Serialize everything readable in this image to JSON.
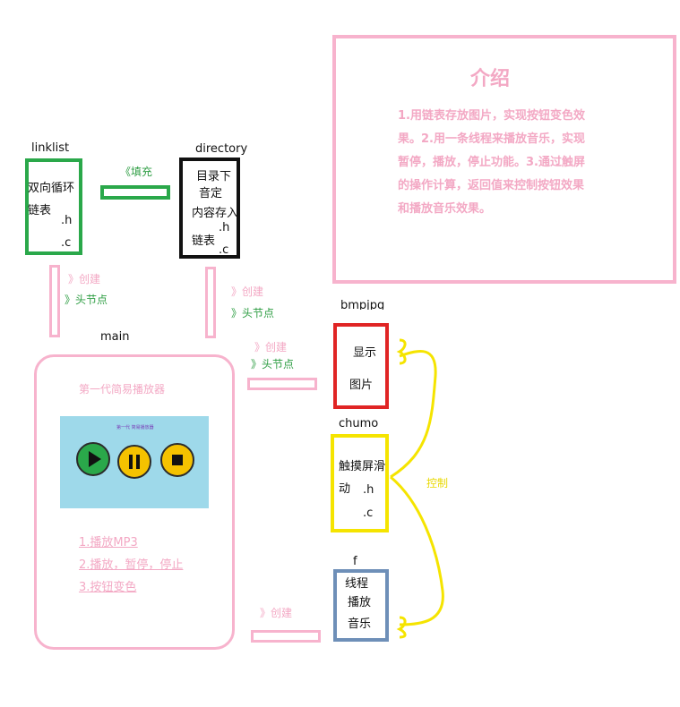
{
  "intro": {
    "title": "介绍",
    "body": "1.用链表存放图片，实现按钮变色效果。2.用一条线程来播放音乐，实现暂停，播放，停止功能。3.通过触屏的操作计算，返回值来控制按钮效果和播放音乐效果。"
  },
  "modules": {
    "linklist": {
      "name": "linklist",
      "line1": "双向循环",
      "line2": "链表",
      "h": ".h",
      "c": ".c",
      "color": "#2aa84a"
    },
    "directory": {
      "name": "directory",
      "line1": "目录下",
      "line2": "音定",
      "line3": "内容存入",
      "h": ".h",
      "line4": "链表",
      "c": ".c",
      "color": "#111111"
    },
    "main": {
      "name": "main",
      "player_title": "第一代简易播放器",
      "player_caption": "第一代 简易播放器",
      "color": "#f7b3cd"
    },
    "bmpjpg": {
      "name": "bmpjpg",
      "line1": "显示",
      "line2": "图片",
      "color": "#e02424"
    },
    "chumo": {
      "name": "chumo",
      "line1": "触摸屏滑",
      "line2": "动",
      "h": ".h",
      "c": ".c",
      "color": "#f5e400"
    },
    "f": {
      "name": "f",
      "line1": "线程",
      "line2": "播放",
      "line3": "音乐",
      "color": "#6e8fb8"
    }
  },
  "features": [
    "1.播放MP3",
    "2.播放，暂停，停止",
    "3.按钮变色"
  ],
  "annotations": {
    "fill": "《填充",
    "create": "》创建",
    "head_node": "》头节点",
    "control": "控制"
  },
  "colors": {
    "pink": "#f3a8c4",
    "green": "#2f9e44",
    "yellow": "#f5e400",
    "player_bg": "#9ed9ea"
  }
}
